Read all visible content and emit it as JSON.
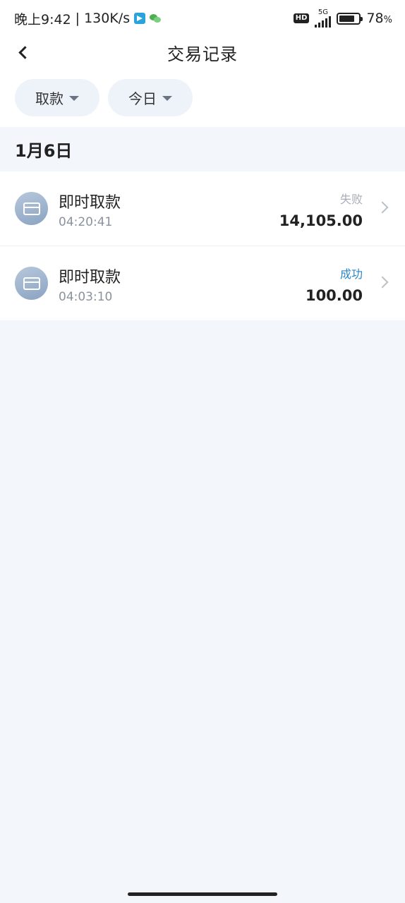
{
  "status_bar": {
    "time": "晚上9:42",
    "separator": "|",
    "network_speed": "130K/s",
    "hd_badge": "HD",
    "network_type": "5G",
    "battery_percent": "78",
    "battery_unit": "%",
    "battery_level": 0.78,
    "icons": [
      "telegram-icon",
      "wechat-icon",
      "signal-icon",
      "battery-icon"
    ]
  },
  "header": {
    "title": "交易记录",
    "back_icon": "chevron-left-icon"
  },
  "filters": {
    "type_label": "取款",
    "date_label": "今日"
  },
  "section": {
    "date": "1月6日"
  },
  "transactions": [
    {
      "title": "即时取款",
      "time": "04:20:41",
      "status": "失败",
      "amount": "14,105.00",
      "status_color": "#a7aeb7"
    },
    {
      "title": "即时取款",
      "time": "04:03:10",
      "status": "成功",
      "amount": "100.00",
      "status_color": "#2b86c7"
    }
  ],
  "colors": {
    "background": "#f3f7fc",
    "surface": "#ffffff",
    "chip": "#eef3fa",
    "success": "#2b86c7",
    "failed": "#a7aeb7"
  }
}
